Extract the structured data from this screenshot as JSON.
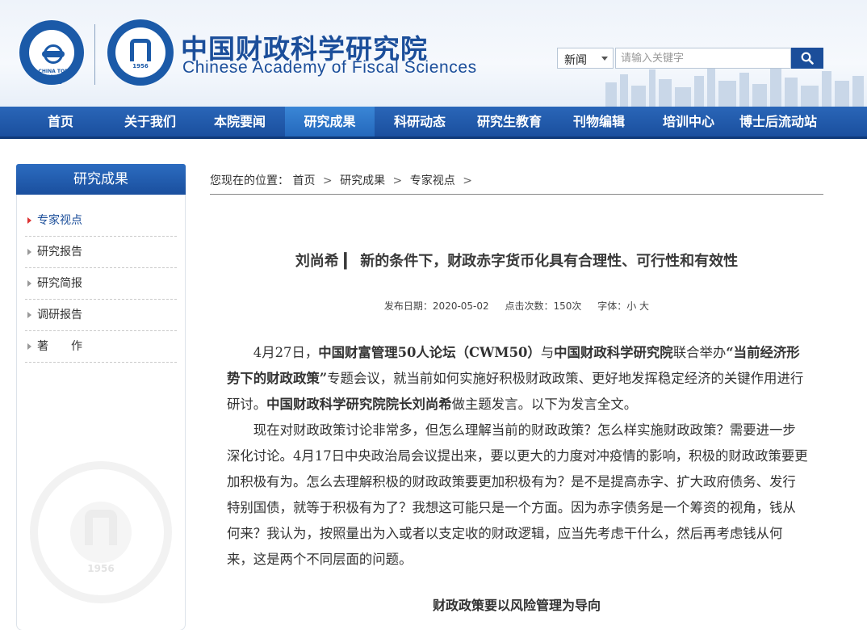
{
  "header": {
    "title_cn": "中国财政科学研究院",
    "title_en": "Chinese Academy of Fiscal Sciences",
    "logo1_text": "CHINA TOP THINK TANKS",
    "logo2_year": "1956"
  },
  "search": {
    "category": "新闻",
    "placeholder": "请输入关键字"
  },
  "nav": [
    "首页",
    "关于我们",
    "本院要闻",
    "研究成果",
    "科研动态",
    "研究生教育",
    "刊物编辑",
    "培训中心",
    "博士后流动站"
  ],
  "sidebar": {
    "title": "研究成果",
    "items": [
      "专家视点",
      "研究报告",
      "研究简报",
      "调研报告",
      "著　　作"
    ]
  },
  "breadcrumb": {
    "prefix": "您现在的位置：",
    "items": [
      "首页",
      "研究成果",
      "专家视点"
    ],
    "sep": ">"
  },
  "article": {
    "title": "刘尚希 ▎ 新的条件下，财政赤字货币化具有合理性、可行性和有效性",
    "date_label": "发布日期：2020-05-02",
    "clicks_label": "点击次数：150次",
    "font_label": "字体：小 大",
    "p1_a": "4月27日，",
    "p1_b": "中国财富管理50人论坛（CWM50）",
    "p1_c": "与",
    "p1_d": "中国财政科学研究院",
    "p1_e": "联合举办",
    "p1_f": "“当前经济形势下的财政政策”",
    "p1_g": "专题会议，就当前如何实施好积极财政政策、更好地发挥稳定经济的关键作用进行研讨。",
    "p1_h": "中国财政科学研究院院长刘尚希",
    "p1_i": "做主题发言。以下为发言全文。",
    "p2": "现在对财政政策讨论非常多，但怎么理解当前的财政政策？怎么样实施财政政策？需要进一步深化讨论。4月17日中央政治局会议提出来，要以更大的力度对冲疫情的影响，积极的财政政策要更加积极有为。怎么去理解积极的财政政策要更加积极有为？是不是提高赤字、扩大政府债务、发行特别国债，就等于积极有为了？我想这可能只是一个方面。因为赤字债务是一个筹资的视角，钱从何来？我认为，按照量出为入或者以支定收的财政逻辑，应当先考虑干什么，然后再考虑钱从何来，这是两个不同层面的问题。",
    "subhead": "财政政策要以风险管理为导向"
  },
  "colors": {
    "brand": "#1b4e9a",
    "nav_bg": "#1a4f9e",
    "nav_active": "#2e7bcf"
  }
}
